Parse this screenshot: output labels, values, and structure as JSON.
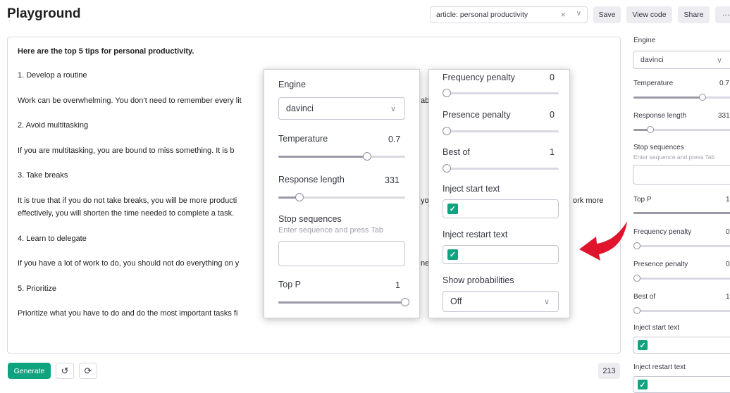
{
  "app": {
    "title": "Playground"
  },
  "header": {
    "preset_value": "article: personal productivity",
    "save_label": "Save",
    "view_code_label": "View code",
    "share_label": "Share",
    "more_label": "···"
  },
  "editor": {
    "lines": [
      "Here are the top 5 tips for personal productivity.",
      "1. Develop a routine",
      "Work can be overwhelming. You don’t need to remember every lit",
      "ab",
      "2. Avoid multitasking",
      "If you are multitasking, you are bound to miss something. It is b",
      "3. Take breaks",
      "It is true that if you do not take breaks, you will be more producti",
      "you",
      "ork more",
      "effectively, you will shorten the time needed to complete a task.",
      "4. Learn to delegate",
      "If you have a lot of work to do, you should not do everything on y",
      "ne",
      "5. Prioritize",
      "Prioritize what you have to do and do the most important tasks fi"
    ]
  },
  "footer": {
    "generate_label": "Generate",
    "token_count": "213"
  },
  "zoom_panel_left": {
    "engine_label": "Engine",
    "engine_value": "davinci",
    "temperature_label": "Temperature",
    "temperature_value": "0.7",
    "temperature_level": 0.7,
    "response_length_label": "Response length",
    "response_length_value": "331",
    "response_length_level": 0.17,
    "stop_sequences_label": "Stop sequences",
    "stop_sequences_hint": "Enter sequence and press Tab",
    "top_p_label": "Top P",
    "top_p_value": "1",
    "top_p_level": 1.0
  },
  "zoom_panel_right": {
    "frequency_penalty_label": "Frequency penalty",
    "frequency_penalty_value": "0",
    "presence_penalty_label": "Presence penalty",
    "presence_penalty_value": "0",
    "best_of_label": "Best of",
    "best_of_value": "1",
    "inject_start_label": "Inject start text",
    "inject_restart_label": "Inject restart text",
    "show_probabilities_label": "Show probabilities",
    "show_probabilities_value": "Off"
  },
  "sidebar": {
    "engine_label": "Engine",
    "engine_value": "davinci",
    "temperature_label": "Temperature",
    "temperature_value": "0.7",
    "response_length_label": "Response length",
    "response_length_value": "331",
    "stop_sequences_label": "Stop sequences",
    "stop_sequences_hint": "Enter sequence and press Tab",
    "top_p_label": "Top P",
    "top_p_value": "1",
    "frequency_penalty_label": "Frequency penalty",
    "frequency_penalty_value": "0",
    "presence_penalty_label": "Presence penalty",
    "presence_penalty_value": "0",
    "best_of_label": "Best of",
    "best_of_value": "1",
    "inject_start_label": "Inject start text",
    "inject_restart_label": "Inject restart text"
  },
  "colors": {
    "accent": "#10a37f",
    "arrow": "#e0152d"
  }
}
